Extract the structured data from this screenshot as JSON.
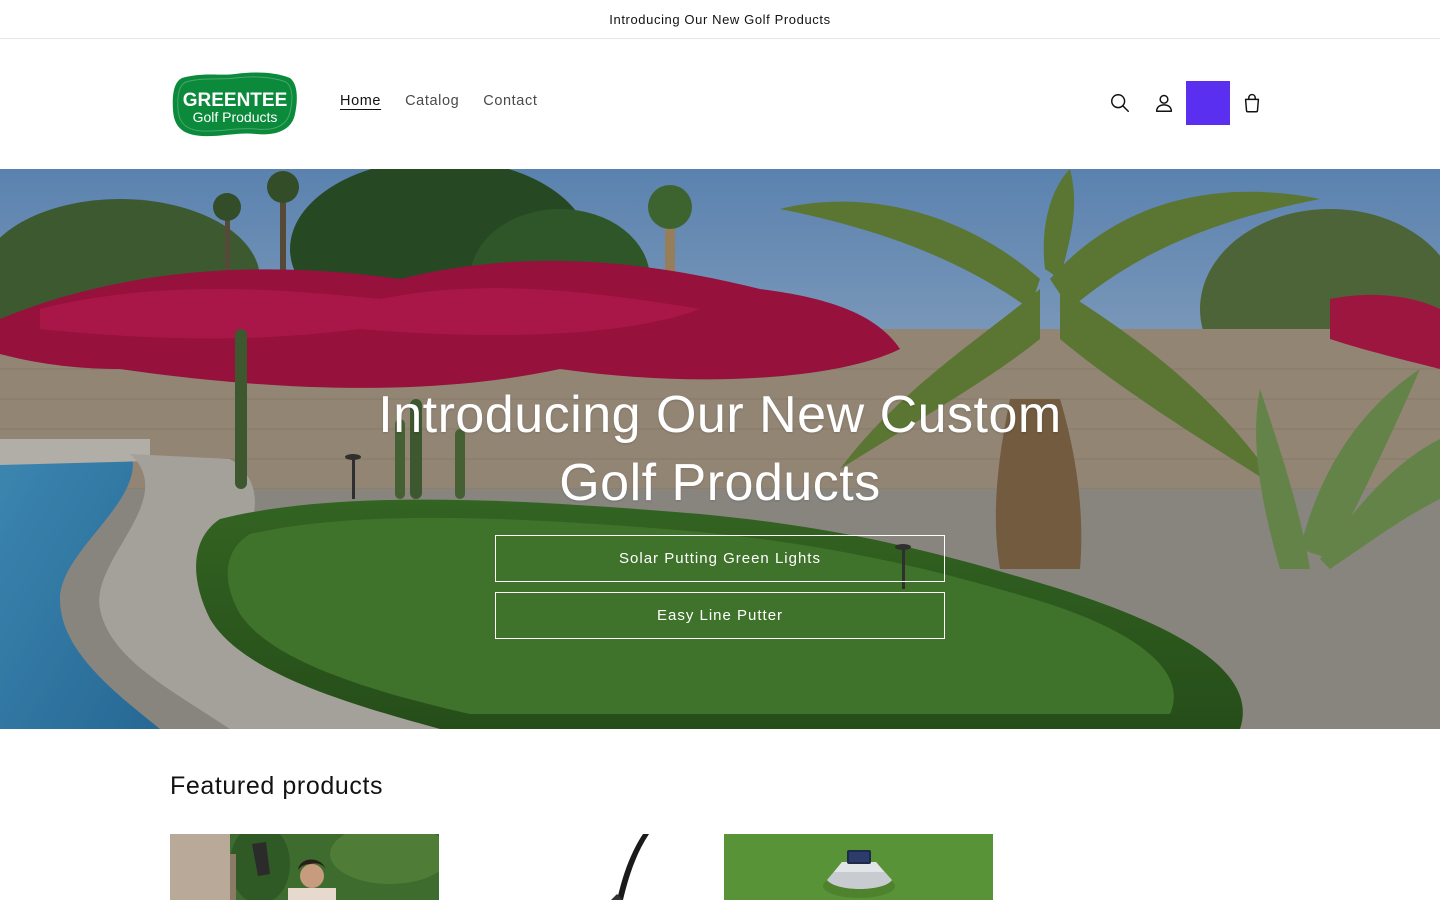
{
  "announcement": {
    "text": "Introducing Our New Golf Products"
  },
  "header": {
    "logo": {
      "line1": "GREENTEE",
      "line2": "Golf Products",
      "color": "#0a8a3a"
    },
    "nav": [
      {
        "label": "Home",
        "active": true
      },
      {
        "label": "Catalog",
        "active": false
      },
      {
        "label": "Contact",
        "active": false
      }
    ],
    "icons": [
      "search-icon",
      "account-icon",
      "cart-icon"
    ],
    "accent_color": "#5a2ff0"
  },
  "hero": {
    "title": "Introducing Our New Custom Golf Products",
    "buttons": [
      {
        "label": "Solar Putting Green Lights"
      },
      {
        "label": "Easy Line Putter"
      }
    ]
  },
  "featured": {
    "title": "Featured products",
    "products": [
      {
        "image": "woman-golfer-photo"
      },
      {
        "image": "putter-photo"
      },
      {
        "image": "solar-light-on-green-photo"
      }
    ]
  }
}
